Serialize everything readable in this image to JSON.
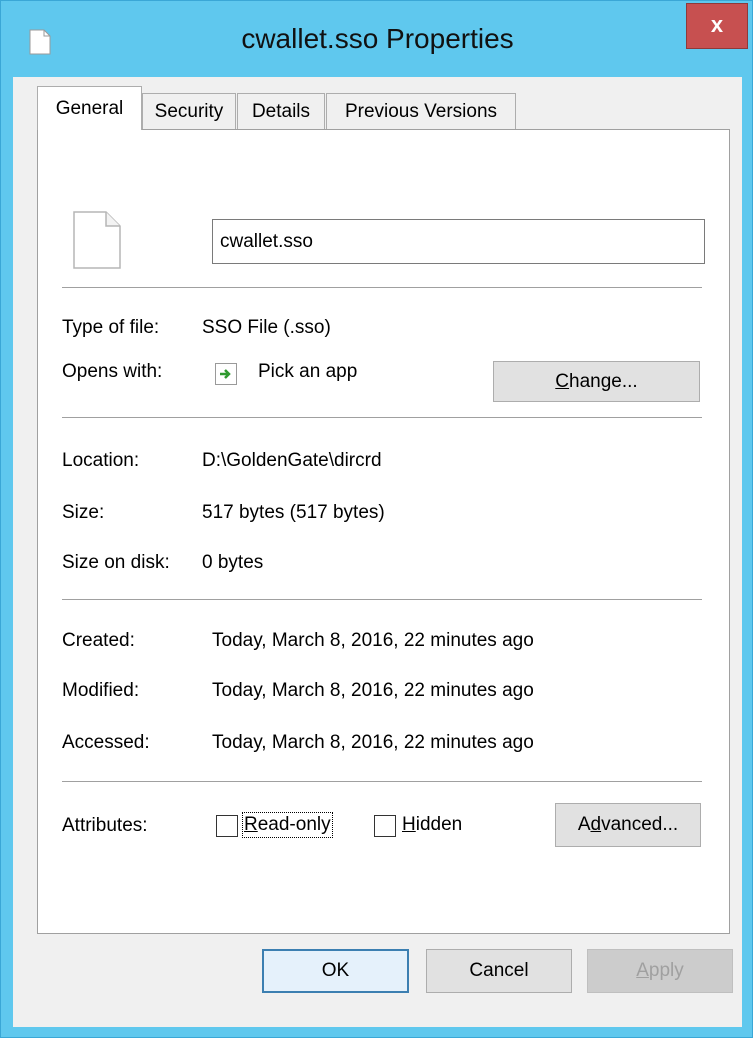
{
  "window": {
    "title": "cwallet.sso Properties",
    "close_glyph": "x"
  },
  "tabs": [
    {
      "label": "General",
      "active": true
    },
    {
      "label": "Security",
      "active": false
    },
    {
      "label": "Details",
      "active": false
    },
    {
      "label": "Previous Versions",
      "active": false
    }
  ],
  "general": {
    "file_name": "cwallet.sso",
    "type_label": "Type of file:",
    "type_value": "SSO File (.sso)",
    "opens_label": "Opens with:",
    "opens_value": "Pick an app",
    "change_button": {
      "accel": "C",
      "rest": "hange..."
    },
    "location_label": "Location:",
    "location_value": "D:\\GoldenGate\\dircrd",
    "size_label": "Size:",
    "size_value": "517 bytes (517 bytes)",
    "size_on_disk_label": "Size on disk:",
    "size_on_disk_value": "0 bytes",
    "created_label": "Created:",
    "created_value": "Today, March 8, 2016, 22 minutes ago",
    "modified_label": "Modified:",
    "modified_value": "Today, March 8, 2016, 22 minutes ago",
    "accessed_label": "Accessed:",
    "accessed_value": "Today, March 8, 2016, 22 minutes ago",
    "attributes_label": "Attributes:",
    "readonly": {
      "accel": "R",
      "rest": "ead-only",
      "checked": false
    },
    "hidden": {
      "accel": "H",
      "rest": "idden",
      "checked": false
    },
    "advanced_button": {
      "pre": "A",
      "accel": "d",
      "rest": "vanced..."
    }
  },
  "footer": {
    "ok": "OK",
    "cancel": "Cancel",
    "apply": {
      "accel": "A",
      "rest": "pply"
    }
  },
  "icons": {
    "title_icon": "document-icon",
    "file_icon": "file-icon",
    "opens_icon": "pick-app-icon"
  },
  "colors": {
    "titlebar": "#5fc8ee",
    "close": "#c75050",
    "dialog": "#f0f0f0",
    "panel": "#ffffff",
    "pick_app_arrow": "#2f9a2f"
  }
}
